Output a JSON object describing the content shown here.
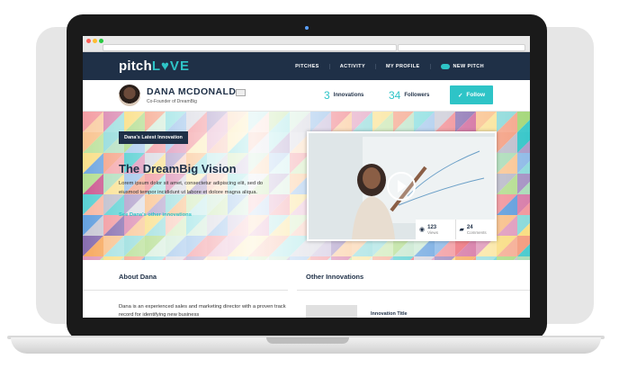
{
  "browser": {
    "address": "",
    "search": ""
  },
  "nav": {
    "logo_prefix": "pitch",
    "logo_suffix": "LVE",
    "links": [
      "PITCHES",
      "ACTIVITY",
      "MY PROFILE"
    ],
    "new_pitch": "NEW PITCH"
  },
  "profile": {
    "name": "DANA MCDONALD",
    "title": "Co-Founder of DreamBig",
    "innovations_count": "3",
    "innovations_label": "Innovations",
    "followers_count": "34",
    "followers_label": "Followers",
    "follow_label": "Follow"
  },
  "hero": {
    "tag": "Dana's Latest Innovation",
    "title": "The DreamBig Vision",
    "description": "Lorem ipsum dolor sit amet, consectetur adipiscing elit, sed do eiusmod tempor incididunt ut labore et dolore magna aliqua.",
    "link": "See Dana's other innovations",
    "views_count": "123",
    "views_label": "Views",
    "comments_count": "24",
    "comments_label": "Comments"
  },
  "about": {
    "title": "About Dana",
    "text": "Dana is an experienced sales and marketing director with a proven track record for identifying new business"
  },
  "other": {
    "title": "Other Innovations",
    "item_title": "Innovation Title"
  },
  "colors": {
    "navy": "#1f3047",
    "teal": "#2ec4c7"
  }
}
